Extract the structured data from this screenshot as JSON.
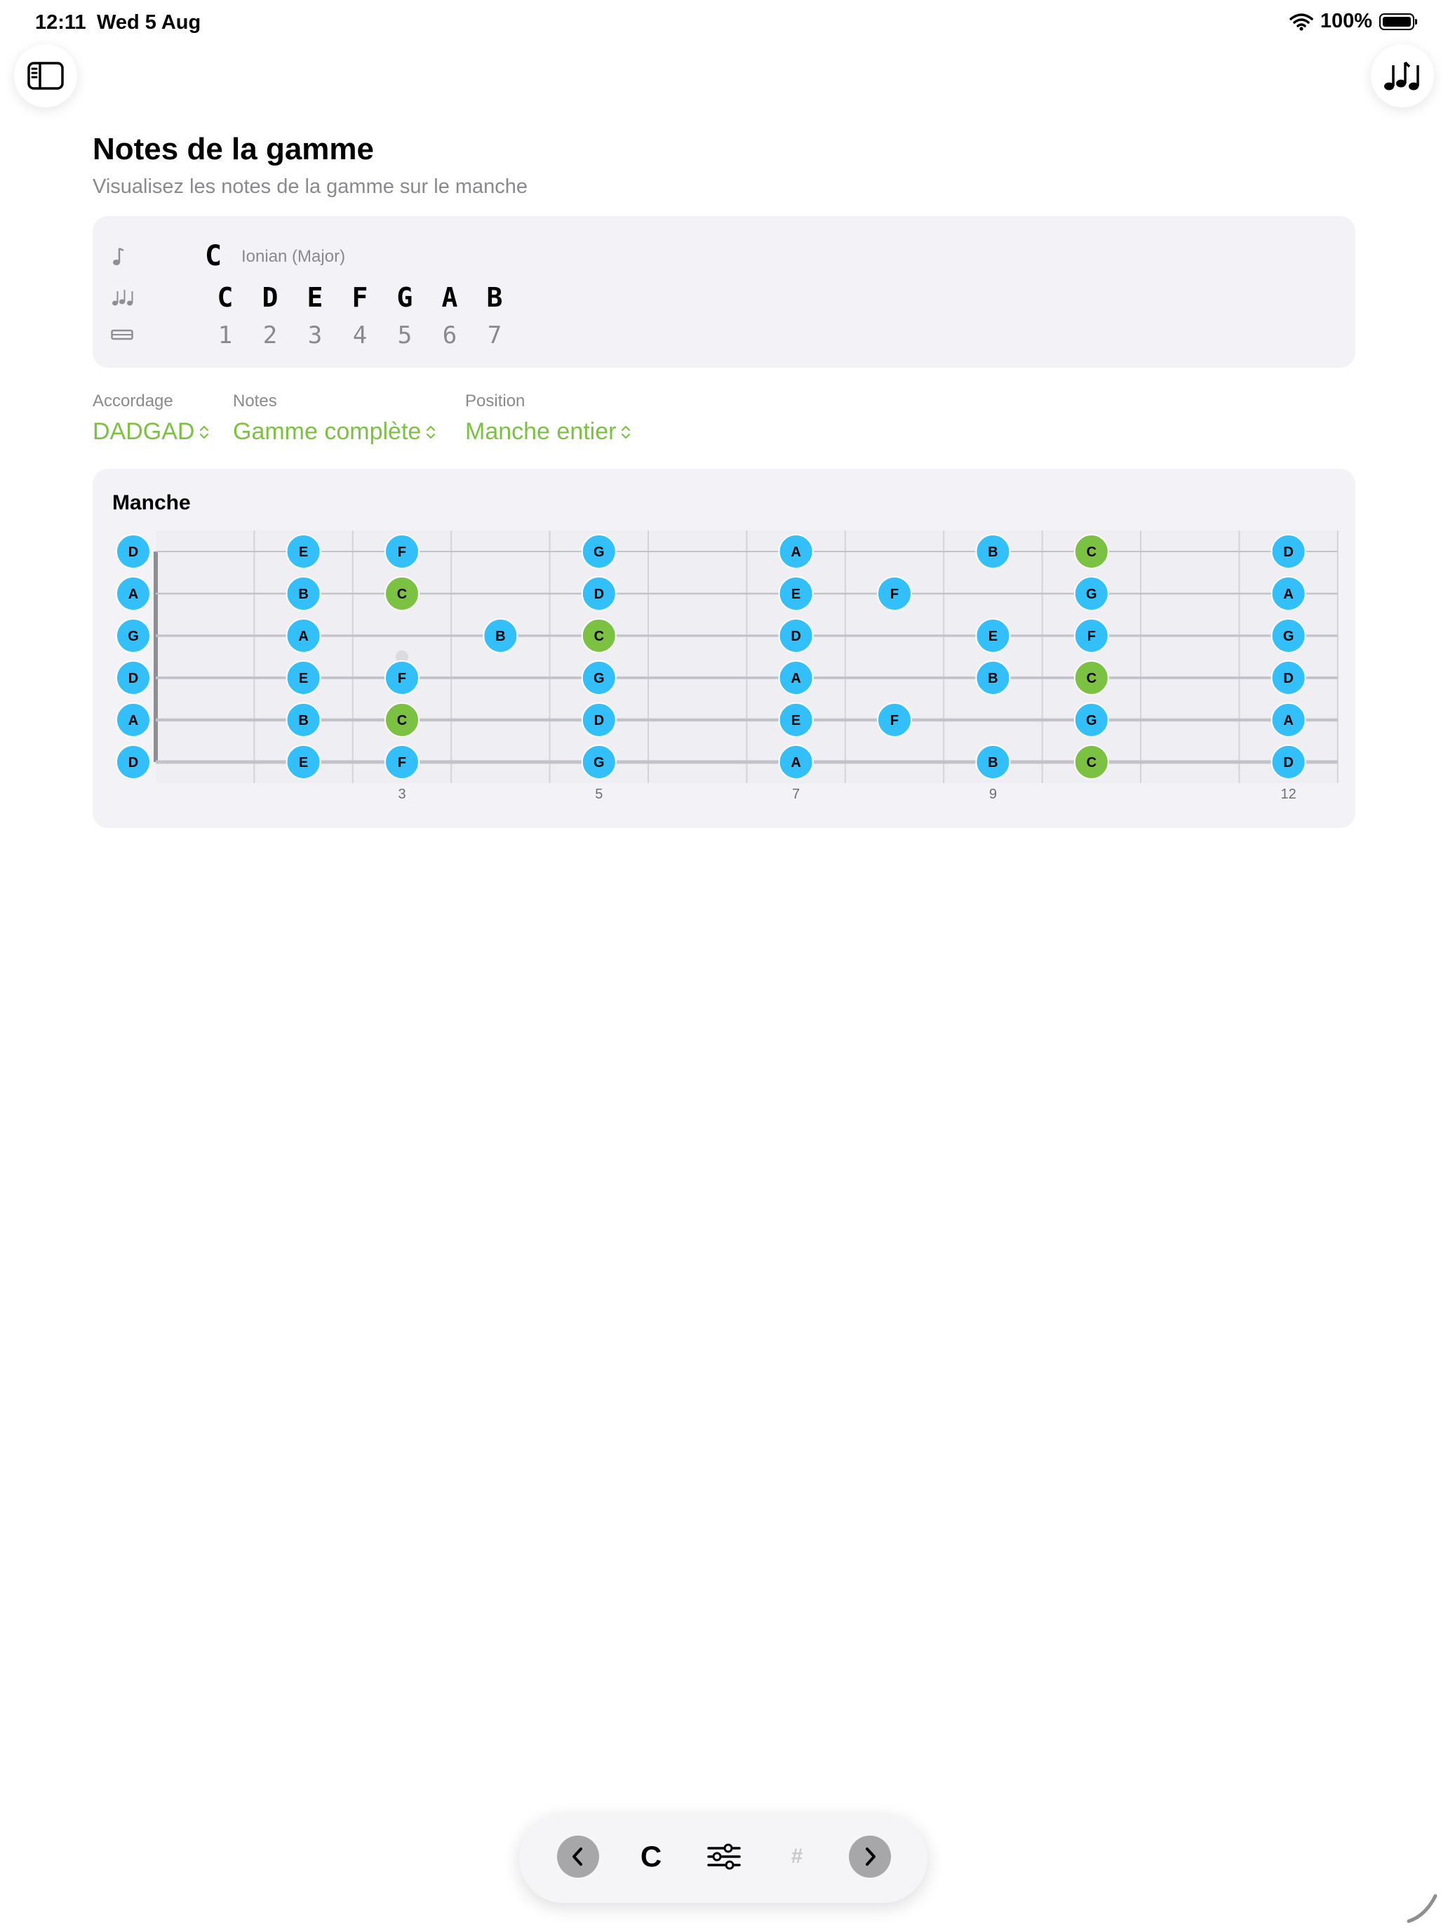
{
  "status_bar": {
    "time": "12:11",
    "date": "Wed 5 Aug",
    "battery": "100%",
    "battery_level": 1.0
  },
  "toolbar_top": {
    "sidebar_icon": "sidebar-toggle-icon",
    "notes_icon": "music-notes-icon"
  },
  "header": {
    "title": "Notes de la gamme",
    "subtitle": "Visualisez les notes de la gamme sur le manche"
  },
  "scale": {
    "root": "C",
    "mode": "Ionian (Major)",
    "notes": [
      "C",
      "D",
      "E",
      "F",
      "G",
      "A",
      "B"
    ],
    "degrees": [
      "1",
      "2",
      "3",
      "4",
      "5",
      "6",
      "7"
    ]
  },
  "pickers": [
    {
      "label": "Accordage",
      "value": "DADGAD"
    },
    {
      "label": "Notes",
      "value": "Gamme complète"
    },
    {
      "label": "Position",
      "value": "Manche entier"
    }
  ],
  "fretboard": {
    "title": "Manche",
    "root_color": "#7cc242",
    "note_color": "#33bff9",
    "frets": 12,
    "fret_markers": [
      3,
      5,
      7,
      9,
      12
    ],
    "strings": [
      {
        "open": "D",
        "notes": [
          {
            "fret": 0,
            "note": "D"
          },
          {
            "fret": 2,
            "note": "E"
          },
          {
            "fret": 3,
            "note": "F"
          },
          {
            "fret": 5,
            "note": "G"
          },
          {
            "fret": 7,
            "note": "A"
          },
          {
            "fret": 9,
            "note": "B"
          },
          {
            "fret": 10,
            "note": "C"
          },
          {
            "fret": 12,
            "note": "D"
          }
        ]
      },
      {
        "open": "A",
        "notes": [
          {
            "fret": 0,
            "note": "A"
          },
          {
            "fret": 2,
            "note": "B"
          },
          {
            "fret": 3,
            "note": "C"
          },
          {
            "fret": 5,
            "note": "D"
          },
          {
            "fret": 7,
            "note": "E"
          },
          {
            "fret": 8,
            "note": "F"
          },
          {
            "fret": 10,
            "note": "G"
          },
          {
            "fret": 12,
            "note": "A"
          }
        ]
      },
      {
        "open": "G",
        "notes": [
          {
            "fret": 0,
            "note": "G"
          },
          {
            "fret": 2,
            "note": "A"
          },
          {
            "fret": 4,
            "note": "B"
          },
          {
            "fret": 5,
            "note": "C"
          },
          {
            "fret": 7,
            "note": "D"
          },
          {
            "fret": 9,
            "note": "E"
          },
          {
            "fret": 10,
            "note": "F"
          },
          {
            "fret": 12,
            "note": "G"
          }
        ]
      },
      {
        "open": "D",
        "notes": [
          {
            "fret": 0,
            "note": "D"
          },
          {
            "fret": 2,
            "note": "E"
          },
          {
            "fret": 3,
            "note": "F"
          },
          {
            "fret": 5,
            "note": "G"
          },
          {
            "fret": 7,
            "note": "A"
          },
          {
            "fret": 9,
            "note": "B"
          },
          {
            "fret": 10,
            "note": "C"
          },
          {
            "fret": 12,
            "note": "D"
          }
        ]
      },
      {
        "open": "A",
        "notes": [
          {
            "fret": 0,
            "note": "A"
          },
          {
            "fret": 2,
            "note": "B"
          },
          {
            "fret": 3,
            "note": "C"
          },
          {
            "fret": 5,
            "note": "D"
          },
          {
            "fret": 7,
            "note": "E"
          },
          {
            "fret": 8,
            "note": "F"
          },
          {
            "fret": 10,
            "note": "G"
          },
          {
            "fret": 12,
            "note": "A"
          }
        ]
      },
      {
        "open": "D",
        "notes": [
          {
            "fret": 0,
            "note": "D"
          },
          {
            "fret": 2,
            "note": "E"
          },
          {
            "fret": 3,
            "note": "F"
          },
          {
            "fret": 5,
            "note": "G"
          },
          {
            "fret": 7,
            "note": "A"
          },
          {
            "fret": 9,
            "note": "B"
          },
          {
            "fret": 10,
            "note": "C"
          },
          {
            "fret": 12,
            "note": "D"
          }
        ]
      }
    ]
  },
  "bottom_toolbar": {
    "prev_icon": "chevron-left-icon",
    "key_label": "C",
    "settings_icon": "sliders-icon",
    "sharp_label": "#",
    "next_icon": "chevron-right-icon"
  }
}
